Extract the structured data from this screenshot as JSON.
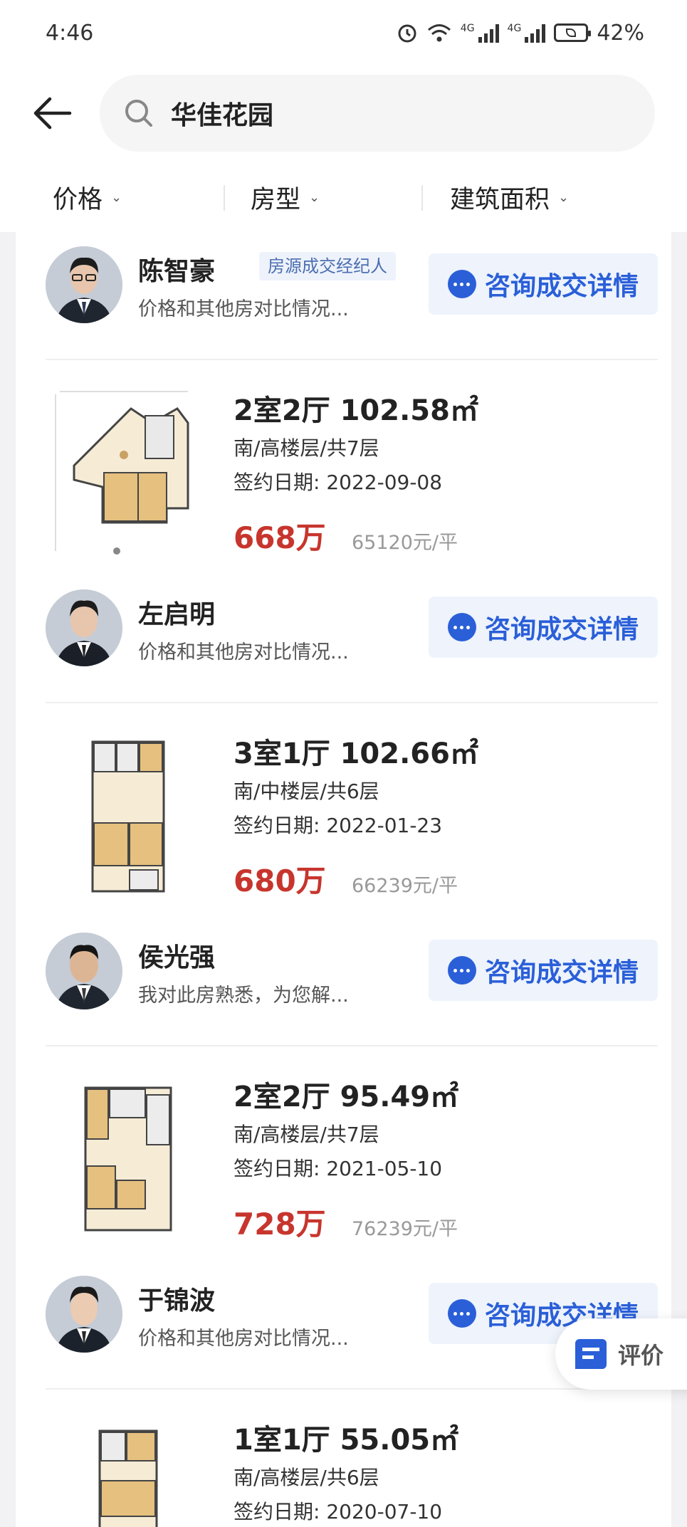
{
  "status_bar": {
    "time": "4:46",
    "battery": "42%",
    "network_tag": "4G"
  },
  "search": {
    "query": "华佳花园"
  },
  "filters": [
    {
      "label": "价格"
    },
    {
      "label": "房型"
    },
    {
      "label": "建筑面积"
    }
  ],
  "consult_label": "咨询成交详情",
  "agents": [
    {
      "name": "陈智豪",
      "badge": "房源成交经纪人",
      "desc": "价格和其他房对比情况..."
    },
    {
      "name": "左启明",
      "desc": "价格和其他房对比情况..."
    },
    {
      "name": "侯光强",
      "desc": "我对此房熟悉，为您解..."
    },
    {
      "name": "于锦波",
      "desc": "价格和其他房对比情况..."
    }
  ],
  "listings": [
    {
      "title": "2室2厅 102.58㎡",
      "floor": "南/高楼层/共7层",
      "date": "签约日期: 2022-09-08",
      "price": "668万",
      "unit_price": "65120元/平"
    },
    {
      "title": "3室1厅 102.66㎡",
      "floor": "南/中楼层/共6层",
      "date": "签约日期: 2022-01-23",
      "price": "680万",
      "unit_price": "66239元/平"
    },
    {
      "title": "2室2厅 95.49㎡",
      "floor": "南/高楼层/共7层",
      "date": "签约日期: 2021-05-10",
      "price": "728万",
      "unit_price": "76239元/平"
    },
    {
      "title": "1室1厅 55.05㎡",
      "floor": "南/高楼层/共6层",
      "date": "签约日期: 2020-07-10"
    }
  ],
  "rating_button": {
    "label": "评价"
  },
  "colors": {
    "accent": "#2a5fd8",
    "price": "#c7352d"
  }
}
